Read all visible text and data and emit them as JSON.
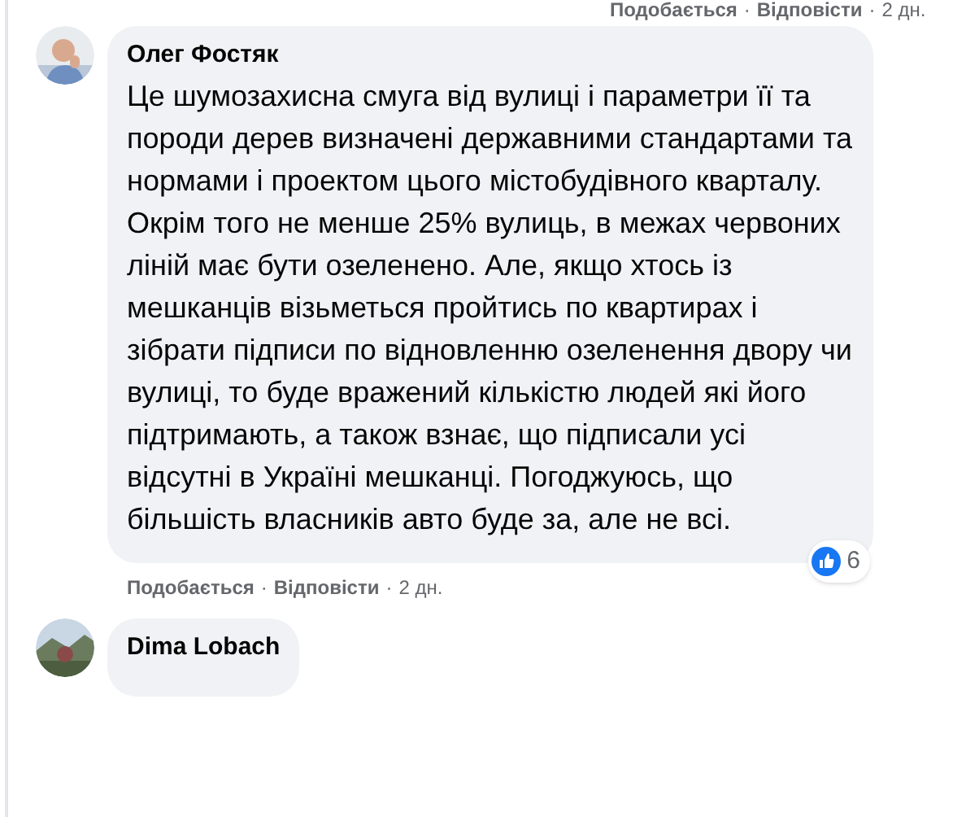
{
  "separator": "·",
  "previous_comment": {
    "actions": [
      "Подобається",
      "Відповісти"
    ],
    "time": "2 дн."
  },
  "comments": [
    {
      "author": "Олег Фостяк",
      "text": "Це шумозахисна смуга від вулиці і параметри її та породи дерев визначені державними стандартами та нормами і проектом цього містобудівного кварталу. Окрім того не менше 25% вулиць, в межах червоних ліній має бути озеленено. Але, якщо хтось із мешканців візьметься пройтись по квартирах і зібрати підписи по відновленню озеленення двору чи вулиці, то буде вражений кількістю людей які його підтримають, а також взнає, що підписали усі відсутні в Україні мешканці. Погоджуюсь, що більшість власників авто буде за, але не всі.",
      "reaction_count": "6",
      "actions": [
        "Подобається",
        "Відповісти"
      ],
      "time": "2 дн."
    },
    {
      "author": "Dima Lobach"
    }
  ]
}
